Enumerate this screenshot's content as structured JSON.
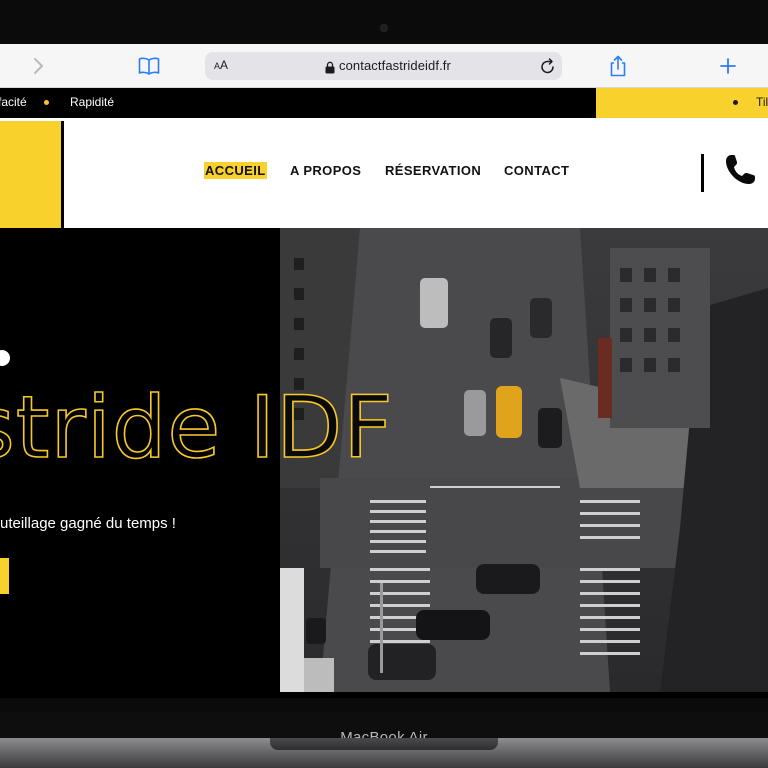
{
  "device": {
    "brand_label": "MacBook Air"
  },
  "browser": {
    "text_size_label": "AA",
    "url": "contactfastrideidf.fr",
    "accent_color": "#2b7cf6"
  },
  "ticker": {
    "items": [
      "facité",
      "Rapidité"
    ],
    "right_text": "Til"
  },
  "header": {
    "nav_items": [
      "ACCUEIL",
      "A PROPOS",
      "RÉSERVATION",
      "CONTACT"
    ],
    "active_item": "ACCUEIL",
    "brand_color": "#f9d12d"
  },
  "hero": {
    "title_outline": "stride ",
    "title_solid": "IDF",
    "subtitle": "uteillage gagné du temps !",
    "title_color": "#f7c928"
  },
  "icons": {
    "forward": "chevron-right-icon",
    "bookmarks": "book-icon",
    "lock": "lock-icon",
    "reload": "reload-icon",
    "share": "share-icon",
    "new_tab": "plus-icon",
    "phone": "phone-icon"
  }
}
